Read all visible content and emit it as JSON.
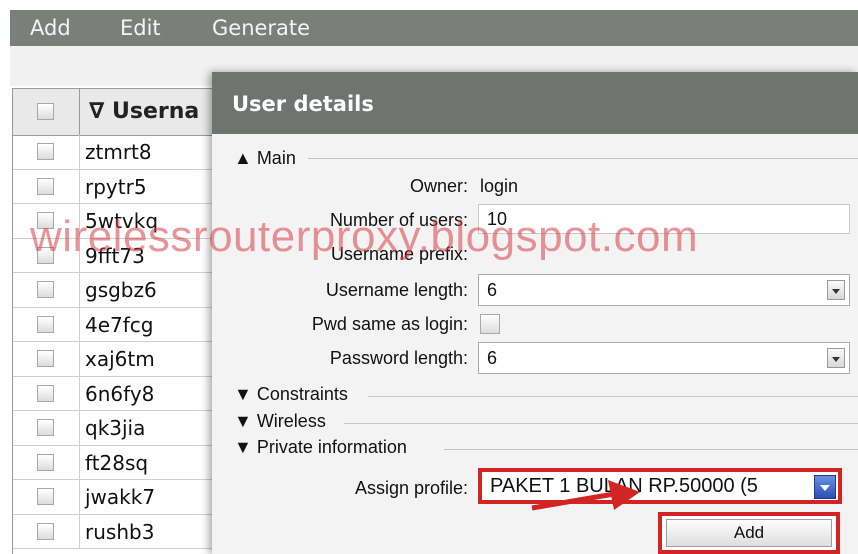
{
  "menu": {
    "items": [
      "Add",
      "Edit",
      "Generate"
    ]
  },
  "table": {
    "header_label": "∇ Userna",
    "usernames": [
      "ztmrt8",
      "rpytr5",
      "5wtvkq",
      "9fft73",
      "gsgbz6",
      "4e7fcg",
      "xaj6tm",
      "6n6fy8",
      "qk3jia",
      "ft28sq",
      "jwakk7",
      "rushb3"
    ]
  },
  "dialog": {
    "title": "User details",
    "sections": {
      "main": "▲ Main",
      "constraints": "▼ Constraints",
      "wireless": "▼ Wireless",
      "private": "▼ Private information"
    },
    "fields": {
      "owner_label": "Owner:",
      "owner_value": "login",
      "num_users_label": "Number of users:",
      "num_users_value": "10",
      "prefix_label": "Username prefix:",
      "prefix_value": "",
      "uname_length_label": "Username length:",
      "uname_length_value": "6",
      "pwd_same_label": "Pwd same as login:",
      "pwd_length_label": "Password length:",
      "pwd_length_value": "6",
      "profile_label": "Assign profile:",
      "profile_value": "PAKET 1 BULAN RP.50000 (5"
    },
    "add_button": "Add"
  },
  "watermark": "wirelessrouterproxy.blogspot.com",
  "colors": {
    "highlight": "#d32424",
    "menubar": "#7a7f7c",
    "titlebar": "#6f7471"
  }
}
